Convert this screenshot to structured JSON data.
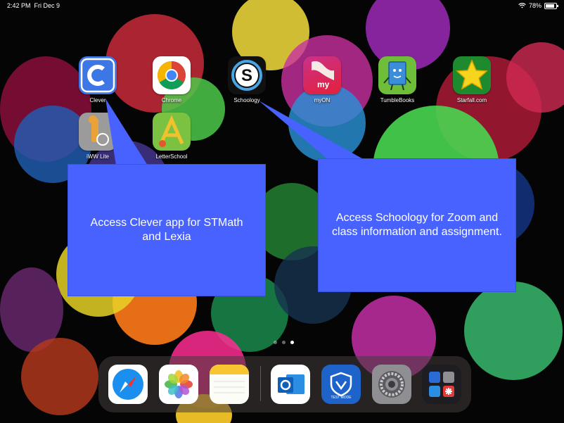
{
  "status_bar": {
    "time": "2:42 PM",
    "date": "Fri Dec 9",
    "battery": "78%",
    "wifi_icon": "wifi-icon"
  },
  "apps": [
    {
      "label": "Clever"
    },
    {
      "label": "Chrome"
    },
    {
      "label": "Schoology"
    },
    {
      "label": "myON"
    },
    {
      "label": "TumbleBooks"
    },
    {
      "label": "Starfall.com"
    },
    {
      "label": "iWW Lite"
    },
    {
      "label": "LetterSchool"
    }
  ],
  "callouts": {
    "clever": "Access Clever app for STMath and Lexia",
    "schoology": "Access Schoology for Zoom and class information and assignment."
  },
  "page_dots": {
    "count": 3,
    "active": 3
  },
  "dock": {
    "apps": [
      "Safari",
      "Photos",
      "Notes",
      "Outlook",
      "Test Mode",
      "Settings",
      "Folder"
    ],
    "test_mode_label": "TEST MODE"
  },
  "colors": {
    "callout": "#4762ff",
    "clever": "#3d77e6",
    "schoology": "#111111"
  }
}
